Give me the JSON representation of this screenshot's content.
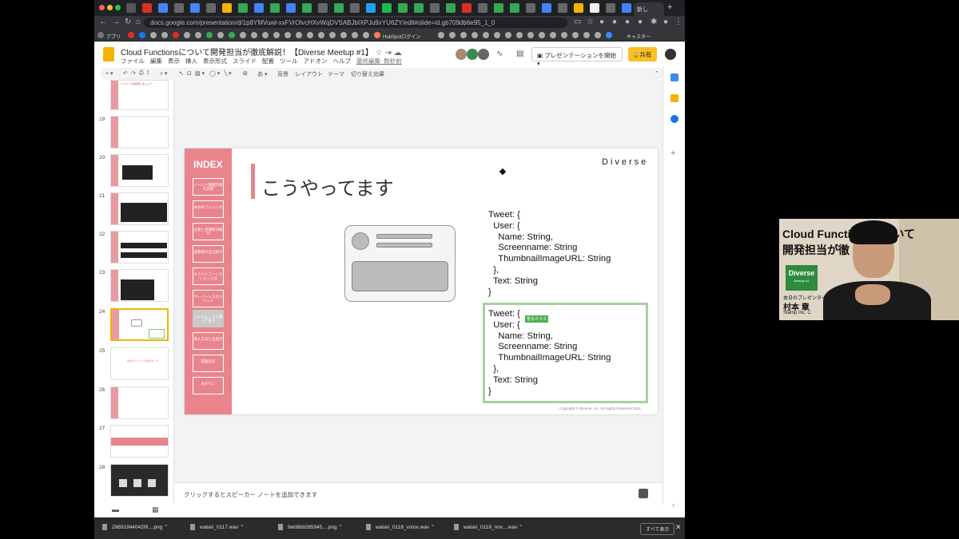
{
  "browser": {
    "active_tab_label": "新し",
    "url": "docs.google.com/presentation/d/1p8YMVuwl-xxFVrOlvcHXvWqDVSABJbIXPJu9xYU6ZY/edit#slide=id.gb709db6e95_1_0",
    "bookmarks_label": "アプリ",
    "bookmark_hubspot": "HubSpotログイン",
    "bookmark_caster": "キャスター"
  },
  "app": {
    "title": "Cloud Functionsについて開発担当が徹底解説！【Diverse Meetup #1】",
    "menus": [
      "ファイル",
      "編集",
      "表示",
      "挿入",
      "表示形式",
      "スライド",
      "配置",
      "ツール",
      "アドオン",
      "ヘルプ"
    ],
    "last_edit": "最終編集: 数秒前",
    "present_label": "プレゼンテーションを開始",
    "share_label": "共有"
  },
  "toolbar": {
    "background": "背景",
    "layout": "レイアウト",
    "theme": "テーマ",
    "transition": "切り替え効果"
  },
  "filmstrip": {
    "numbers": [
      "19",
      "20",
      "21",
      "22",
      "23",
      "24",
      "25",
      "26",
      "27",
      "28"
    ],
    "top_partial_text": "パッケージを配置しましょう",
    "thumb25_text": "最後のスライドを確認中です"
  },
  "slide": {
    "index_title": "INDEX",
    "index_items": [
      "イベント開催内容を説明",
      "本日のアジェンダ",
      "企業と登壇者の紹介",
      "登壇者の自己紹介",
      "クラウドファンクションとは",
      "サーバーレスのメリット",
      "こんなところに使ってます",
      "導入方法と注意点",
      "質疑応答",
      "おわりに"
    ],
    "selected_index": 6,
    "title": "こうやってます",
    "brand": "Diverse",
    "code_top": "Tweet: {\n  User: {\n    Name: String,\n    Screenname: String\n    ThumbnailImageURL: String\n  },\n  Text: String\n}",
    "code_bottom": "Tweet: {\n  User: {\n    Name: String,\n    Screenname: String\n    ThumbnailImageURL: String\n  },\n  Text: String\n}",
    "chip_label": "雪るカラス",
    "copyright": "Copyright © Diverse, Inc. All Rights Reserved 2021"
  },
  "notes": {
    "placeholder": "クリックするとスピーカー ノートを追加できます"
  },
  "downloads": {
    "items": [
      "29691944042f8....png",
      "watari_0117.wav",
      "9eb9b9265945....png",
      "watari_0118_voice.wav",
      "watari_0118_nov....wav"
    ],
    "show_all": "すべて表示"
  },
  "webcam": {
    "title_line1": "Cloud Functionsについて",
    "title_line2": "開発担当が徹",
    "badge": "Diverse",
    "badge_sub": "Meetup #1",
    "presenter_label": "本日のプレゼンター",
    "presenter_name": "村本 章",
    "company": "Stamp Inc. C"
  },
  "colors": {
    "accent_pink": "#e8848c",
    "share_yellow": "#f8c023",
    "highlight_green": "#a7d1a0"
  }
}
